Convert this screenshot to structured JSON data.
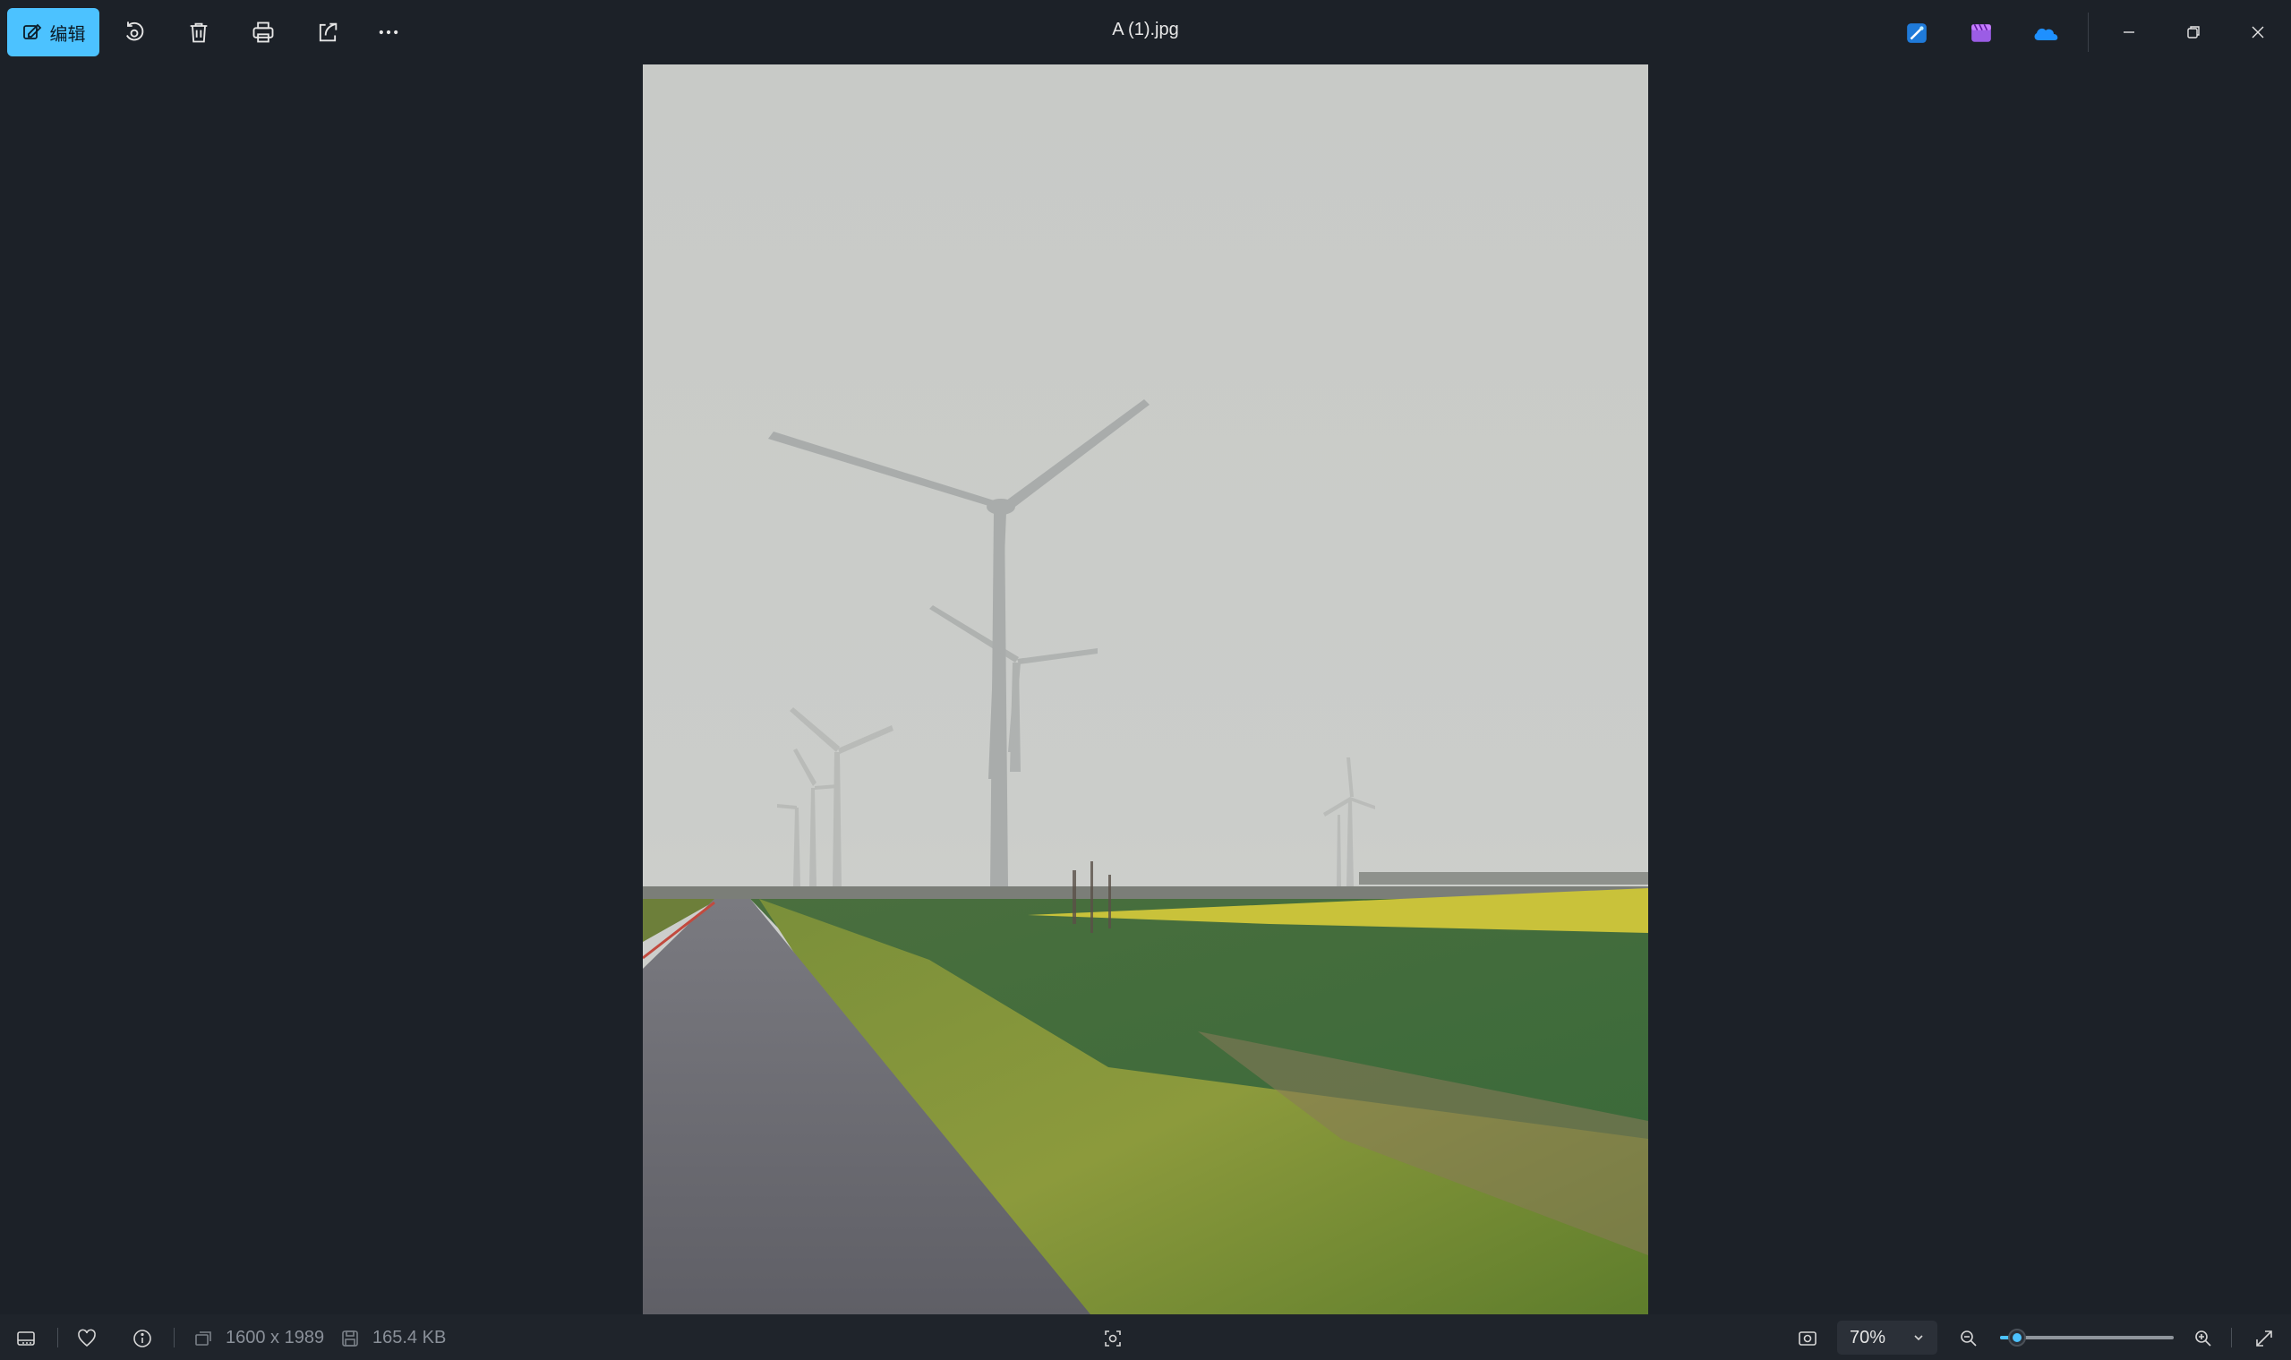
{
  "toolbar": {
    "edit_label": "编辑",
    "file_title": "A (1).jpg",
    "icons": [
      "edit-icon",
      "rotate-icon",
      "delete-icon",
      "print-icon",
      "share-icon",
      "more-icon"
    ],
    "app_icons": [
      "designer-icon",
      "clipchamp-icon",
      "onedrive-icon"
    ],
    "window_controls": [
      "minimize-icon",
      "restore-icon",
      "close-icon"
    ]
  },
  "photo": {
    "description_colors": {
      "sky": "#c9cbc8",
      "field": "#3f6b3a",
      "road": "#6d6d72",
      "flowers": "#c9c23a"
    }
  },
  "statusbar": {
    "dimensions": "1600 x 1989",
    "file_size": "165.4 KB",
    "zoom_value": "70%",
    "zoom_fraction": 0.1
  },
  "colors": {
    "accent": "#4cc2ff",
    "background": "#1c2128"
  }
}
